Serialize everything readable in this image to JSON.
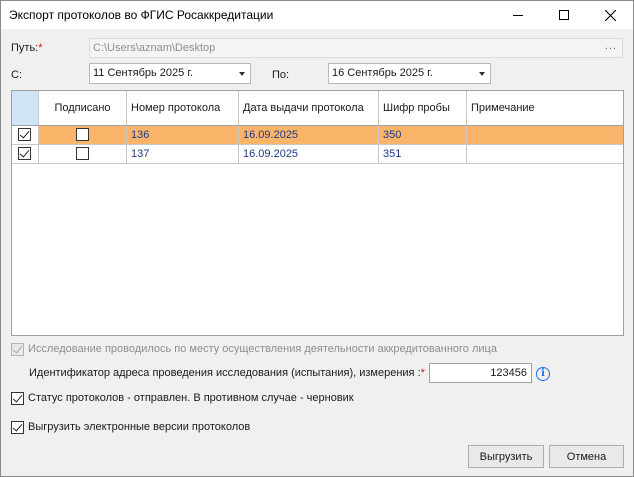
{
  "window": {
    "title": "Экспорт протоколов во ФГИС Росаккредитации"
  },
  "path": {
    "label": "Путь:",
    "required_mark": "*",
    "value": "C:\\Users\\aznam\\Desktop",
    "browse_label": "..."
  },
  "date_from": {
    "label": "С:",
    "value": "11 Сентябрь 2025 г."
  },
  "date_to": {
    "label": "По:",
    "value": "16 Сентябрь 2025 г."
  },
  "grid": {
    "columns": [
      {
        "key": "select",
        "label": ""
      },
      {
        "key": "signed",
        "label": "Подписано"
      },
      {
        "key": "number",
        "label": "Номер протокола"
      },
      {
        "key": "issue_date",
        "label": "Дата выдачи протокола"
      },
      {
        "key": "sample_code",
        "label": "Шифр пробы"
      },
      {
        "key": "note",
        "label": "Примечание"
      }
    ],
    "rows": [
      {
        "selected": true,
        "checked": true,
        "signed": false,
        "number": "136",
        "issue_date": "16.09.2025",
        "sample_code": "350",
        "note": ""
      },
      {
        "selected": false,
        "checked": true,
        "signed": false,
        "number": "137",
        "issue_date": "16.09.2025",
        "sample_code": "351",
        "note": ""
      }
    ]
  },
  "options": {
    "onsite": {
      "label": "Исследование проводилось по месту осуществления деятельности аккредитованного лица",
      "checked": true,
      "enabled": false
    },
    "status_sent": {
      "label": "Статус протоколов - отправлен. В противном случае - черновик",
      "checked": true,
      "enabled": true
    },
    "export_electronic": {
      "label": "Выгрузить электронные версии протоколов",
      "checked": true,
      "enabled": true
    }
  },
  "address_id": {
    "label": "Идентификатор адреса проведения исследования (испытания), измерения :",
    "required_mark": "*",
    "value": "123456",
    "info_icon": "info-icon"
  },
  "buttons": {
    "export_label": "Выгрузить",
    "cancel_label": "Отмена"
  },
  "colors": {
    "selected_row": "#fbb56b",
    "required": "#d01616",
    "info": "#1a73e8"
  }
}
